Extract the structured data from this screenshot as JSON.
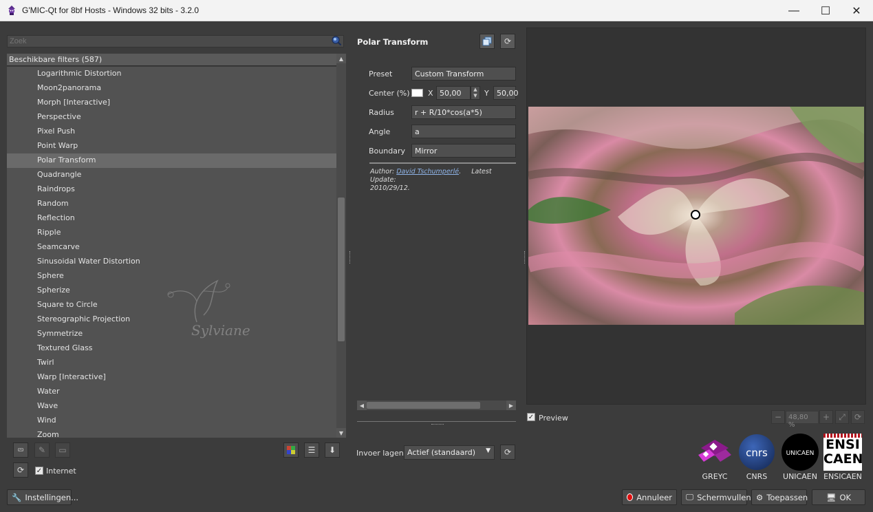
{
  "window": {
    "title": "G'MIC-Qt for 8bf Hosts - Windows 32 bits - 3.2.0",
    "minimize_glyph": "—",
    "maximize_glyph": "☐",
    "close_glyph": "✕"
  },
  "search": {
    "placeholder": "Zoek"
  },
  "filters": {
    "header": "Beschikbare filters (587)",
    "items": [
      {
        "label": "Logarithmic Distortion"
      },
      {
        "label": "Moon2panorama"
      },
      {
        "label": "Morph [Interactive]"
      },
      {
        "label": "Perspective"
      },
      {
        "label": "Pixel Push"
      },
      {
        "label": "Point Warp"
      },
      {
        "label": "Polar Transform",
        "selected": true
      },
      {
        "label": "Quadrangle"
      },
      {
        "label": "Raindrops"
      },
      {
        "label": "Random"
      },
      {
        "label": "Reflection"
      },
      {
        "label": "Ripple"
      },
      {
        "label": "Seamcarve"
      },
      {
        "label": "Sinusoidal Water Distortion"
      },
      {
        "label": "Sphere"
      },
      {
        "label": "Spherize"
      },
      {
        "label": "Square to Circle"
      },
      {
        "label": "Stereographic Projection"
      },
      {
        "label": "Symmetrize"
      },
      {
        "label": "Textured Glass"
      },
      {
        "label": "Twirl"
      },
      {
        "label": "Warp [Interactive]"
      },
      {
        "label": "Water"
      },
      {
        "label": "Wave"
      },
      {
        "label": "Wind"
      },
      {
        "label": "Zoom"
      }
    ],
    "watermark_text": "Sylviane",
    "internet_label": "Internet",
    "internet_checked": true
  },
  "filter_panel": {
    "title": "Polar Transform",
    "params": {
      "preset_label": "Preset",
      "preset_value": "Custom Transform",
      "center_label": "Center (%)",
      "center_x_label": "X",
      "center_x_value": "50,00",
      "center_y_label": "Y",
      "center_y_value": "50,00",
      "radius_label": "Radius",
      "radius_value": "r + R/10*cos(a*5)",
      "angle_label": "Angle",
      "angle_value": "a",
      "boundary_label": "Boundary",
      "boundary_value": "Mirror"
    },
    "author_prefix": "Author:",
    "author_name": "David Tschumperlé",
    "latest_update_label": "Latest Update:",
    "latest_update_value": "2010/29/12."
  },
  "input_layers": {
    "label": "Invoer lagen",
    "value": "Actief (standaard)"
  },
  "preview": {
    "checkbox_label": "Preview",
    "checked": true,
    "zoom": "48,80 %"
  },
  "logos": [
    {
      "label": "GREYC"
    },
    {
      "label": "CNRS"
    },
    {
      "label": "UNICAEN"
    },
    {
      "label": "ENSICAEN"
    }
  ],
  "logo_texts": {
    "cnrs": "cnrs",
    "unicaen": "UNICAEN",
    "ensi": "ENSI",
    "caen": "CAEN"
  },
  "buttons": {
    "settings": "Instellingen...",
    "cancel": "Annuleer",
    "fullscreen": "Schermvullend",
    "apply": "Toepassen",
    "ok": "OK"
  },
  "colors": {
    "background": "#3c3c3c",
    "list_background": "#525252",
    "selected_row": "#6a6a6a",
    "link": "#8fb4e8",
    "cancel_red": "#e01010"
  }
}
